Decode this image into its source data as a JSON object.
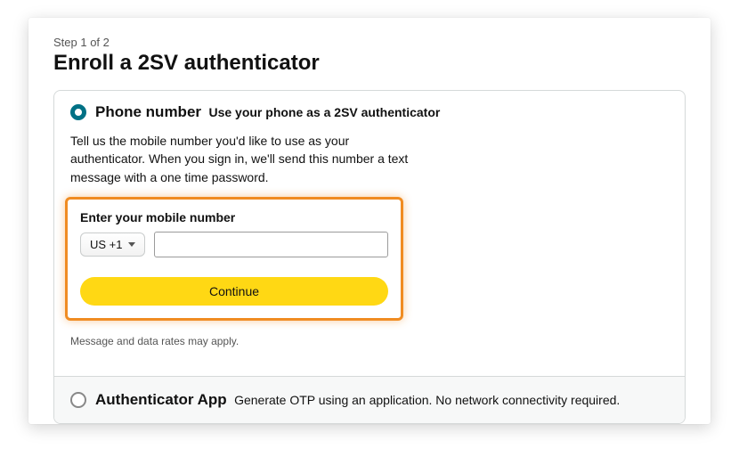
{
  "step": "Step 1 of 2",
  "title": "Enroll a 2SV authenticator",
  "phone_option": {
    "title": "Phone number",
    "subtitle": "Use your phone as a 2SV authenticator",
    "description": "Tell us the mobile number you'd like to use as your authenticator. When you sign in, we'll send this number a text message with a one time password.",
    "field_label": "Enter your mobile number",
    "country_code": "US +1",
    "phone_value": "",
    "continue_label": "Continue",
    "disclaimer": "Message and data rates may apply."
  },
  "app_option": {
    "title": "Authenticator App",
    "subtitle": "Generate OTP using an application. No network connectivity required."
  }
}
